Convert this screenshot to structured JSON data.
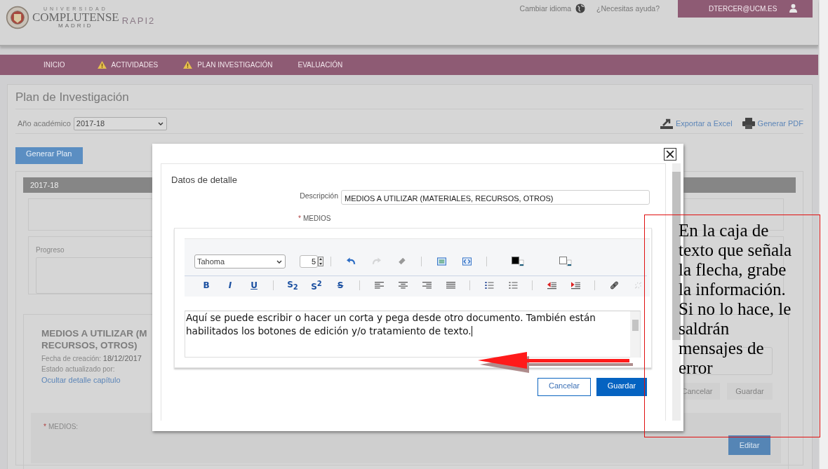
{
  "header": {
    "logo": {
      "top": "UNIVERSIDAD",
      "name": "COMPLUTENSE",
      "city": "MADRID"
    },
    "app_name": "RAPI2",
    "language_link": "Cambiar idioma",
    "help_link": "¿Necesitas ayuda?",
    "user": "DTERCER@UCM.ES"
  },
  "nav": [
    {
      "label": "INICIO",
      "warning": false
    },
    {
      "label": "ACTIVIDADES",
      "warning": true
    },
    {
      "label": "PLAN INVESTIGACIÓN",
      "warning": true
    },
    {
      "label": "EVALUACIÓN",
      "warning": false
    }
  ],
  "page": {
    "title": "Plan de Investigación",
    "year_label": "Año académico",
    "year_value": "2017-18",
    "export_link": "Exportar a Excel",
    "pdf_link": "Generar PDF",
    "generate_button": "Generar Plan",
    "section_header": "2017-18",
    "progress_label": "Progreso",
    "item": {
      "title_lines": [
        "MEDIOS A UTILIZAR (M",
        "RECURSOS, OTROS)"
      ],
      "created_label": "Fecha de creación:",
      "created_value": "18/12/2017",
      "updated_label": "Estado actualizado por:",
      "hide_link": "Ocultar detalle capítulo",
      "cancel_button": "Cancelar",
      "save_button": "Guardar",
      "field_label": "MEDIOS:",
      "required": true,
      "required_mark": "*",
      "edit_button": "Editar"
    }
  },
  "modal": {
    "title": "Datos de detalle",
    "description_label": "Descripción",
    "description_value": "MEDIOS A UTILIZAR (MATERIALES, RECURSOS, OTROS)",
    "field_label": "MEDIOS",
    "required": true,
    "required_mark": "*",
    "toolbar": {
      "font": "Tahoma",
      "size": "5",
      "row1": [
        [
          {
            "kind": "undo",
            "disabled": false
          },
          {
            "kind": "redo",
            "disabled": true
          },
          {
            "kind": "eraser",
            "disabled": false
          }
        ],
        [
          {
            "kind": "image",
            "disabled": false
          },
          {
            "kind": "source",
            "disabled": false
          }
        ],
        [
          {
            "kind": "text-color",
            "color": "#000000",
            "disabled": false
          },
          {
            "kind": "highlight-color",
            "color": "#ffffff",
            "disabled": false
          }
        ]
      ],
      "row2": [
        [
          {
            "kind": "bold",
            "label": "B",
            "disabled": false
          },
          {
            "kind": "italic",
            "label": "I",
            "disabled": false
          },
          {
            "kind": "underline",
            "label": "U",
            "disabled": false
          }
        ],
        [
          {
            "kind": "subscript",
            "label": "S$_{2}$",
            "disabled": false
          },
          {
            "kind": "superscript",
            "label": "S$^{2}$",
            "disabled": false
          },
          {
            "kind": "strike",
            "label": "S",
            "disabled": false
          }
        ],
        [
          {
            "kind": "align-left",
            "disabled": false
          },
          {
            "kind": "align-center",
            "disabled": false
          },
          {
            "kind": "align-right",
            "disabled": false
          },
          {
            "kind": "justify",
            "disabled": false
          }
        ],
        [
          {
            "kind": "bullet-list",
            "disabled": false
          },
          {
            "kind": "number-list",
            "disabled": false
          }
        ],
        [
          {
            "kind": "outdent",
            "disabled": false
          },
          {
            "kind": "indent",
            "disabled": false
          }
        ],
        [
          {
            "kind": "link",
            "disabled": false
          },
          {
            "kind": "unlink",
            "disabled": true
          }
        ]
      ]
    },
    "text": "Aquí se puede escribir o hacer un corta y pega desde otro documento. También están habilitados los botones de edición y/o tratamiento de texto.",
    "cancel_button": "Cancelar",
    "save_button": "Guardar"
  },
  "annotation": {
    "lines": [
      "En la caja de",
      "texto que señala",
      "la flecha, grabe",
      "la información.",
      "Si no lo hace, le",
      "saldrán",
      "mensajes de",
      "error"
    ]
  }
}
